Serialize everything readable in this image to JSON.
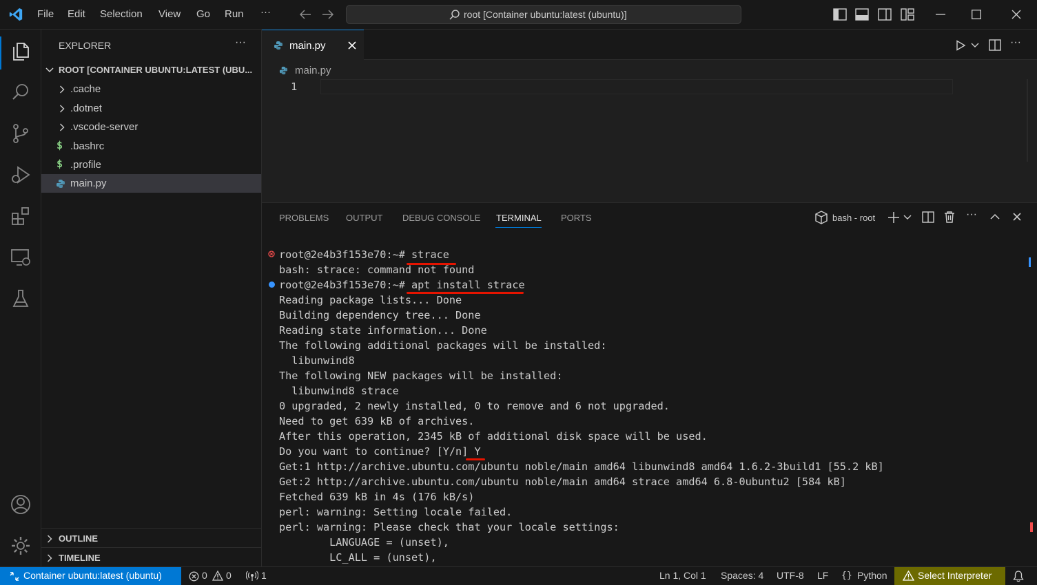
{
  "titlebar": {
    "menu": [
      "File",
      "Edit",
      "Selection",
      "View",
      "Go",
      "Run",
      "···"
    ],
    "command_center": "root [Container ubuntu:latest (ubuntu)]"
  },
  "sidebar": {
    "title": "EXPLORER",
    "more": "···",
    "root_label": "ROOT [CONTAINER UBUNTU:LATEST (UBU...",
    "items": [
      {
        "label": ".cache",
        "kind": "folder"
      },
      {
        "label": ".dotnet",
        "kind": "folder"
      },
      {
        "label": ".vscode-server",
        "kind": "folder"
      },
      {
        "label": ".bashrc",
        "kind": "shell"
      },
      {
        "label": ".profile",
        "kind": "shell"
      },
      {
        "label": "main.py",
        "kind": "python"
      }
    ],
    "outline": "OUTLINE",
    "timeline": "TIMELINE"
  },
  "editor": {
    "tab_label": "main.py",
    "breadcrumb": "main.py",
    "line_number": "1"
  },
  "panel": {
    "tabs": [
      "PROBLEMS",
      "OUTPUT",
      "DEBUG CONSOLE",
      "TERMINAL",
      "PORTS"
    ],
    "active_tab": "TERMINAL",
    "terminal_name": "bash - root",
    "lines": [
      "root@2e4b3f153e70:~# strace",
      "bash: strace: command not found",
      "root@2e4b3f153e70:~# apt install strace",
      "Reading package lists... Done",
      "Building dependency tree... Done",
      "Reading state information... Done",
      "The following additional packages will be installed:",
      "  libunwind8",
      "The following NEW packages will be installed:",
      "  libunwind8 strace",
      "0 upgraded, 2 newly installed, 0 to remove and 6 not upgraded.",
      "Need to get 639 kB of archives.",
      "After this operation, 2345 kB of additional disk space will be used.",
      "Do you want to continue? [Y/n] Y",
      "Get:1 http://archive.ubuntu.com/ubuntu noble/main amd64 libunwind8 amd64 1.6.2-3build1 [55.2 kB]",
      "Get:2 http://archive.ubuntu.com/ubuntu noble/main amd64 strace amd64 6.8-0ubuntu2 [584 kB]",
      "Fetched 639 kB in 4s (176 kB/s)",
      "perl: warning: Setting locale failed.",
      "perl: warning: Please check that your locale settings:",
      "        LANGUAGE = (unset),",
      "        LC_ALL = (unset),"
    ],
    "error_marker_color": "#f14c4c",
    "ok_marker_color": "#3794ff",
    "underline_color": "#e51400"
  },
  "statusbar": {
    "remote": "Container ubuntu:latest (ubuntu)",
    "errors": "0",
    "warnings": "0",
    "ports": "1",
    "position": "Ln 1, Col 1",
    "spaces": "Spaces: 4",
    "encoding": "UTF-8",
    "eol": "LF",
    "language": "Python",
    "interpreter": "Select Interpreter",
    "remote_color": "#0078d4",
    "interpreter_color": "#6c6a00"
  }
}
